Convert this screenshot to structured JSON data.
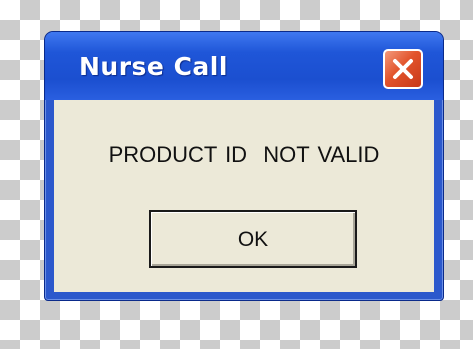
{
  "dialog": {
    "title": "Nurse Call",
    "message": "PRODUCT ID  NOT VALID",
    "ok_label": "OK",
    "close_icon": "close-icon"
  },
  "colors": {
    "titlebar": "#1f56d8",
    "client_background": "#ece9d8",
    "close_button": "#e2542c"
  }
}
